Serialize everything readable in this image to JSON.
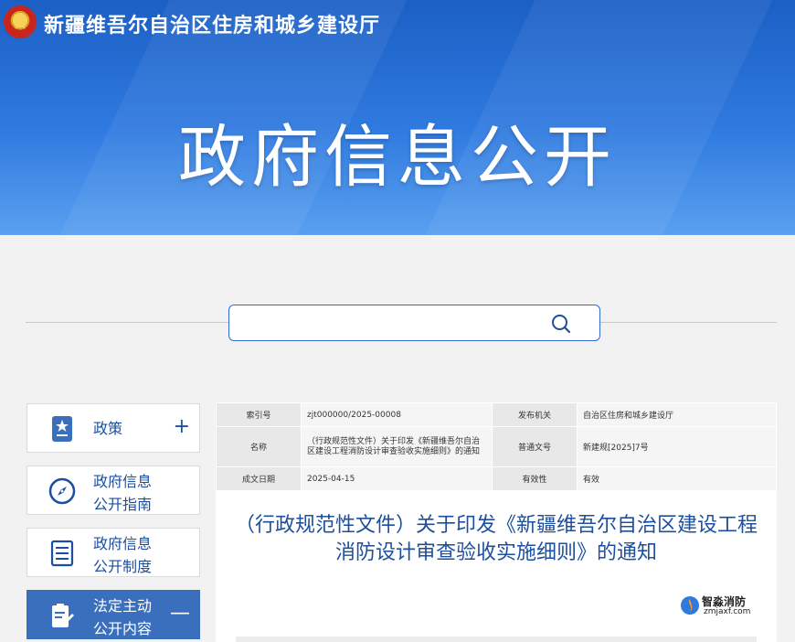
{
  "header": {
    "site_title": "新疆维吾尔自治区住房和城乡建设厅",
    "page_title": "政府信息公开"
  },
  "search": {
    "value": "",
    "placeholder": ""
  },
  "sidebar": {
    "items": [
      {
        "label": "政策",
        "toggle": "+"
      },
      {
        "label": "政府信息\n公开指南"
      },
      {
        "label": "政府信息\n公开制度"
      },
      {
        "label": "法定主动\n公开内容",
        "toggle": "—",
        "active": true
      }
    ]
  },
  "document": {
    "meta": {
      "index_label": "索引号",
      "index_value": "zjt000000/2025-00008",
      "org_label": "发布机关",
      "org_value": "自治区住房和城乡建设厅",
      "name_label": "名称",
      "name_value": "（行政规范性文件）关于印发《新疆维吾尔自治区建设工程消防设计审查验收实施细则》的通知",
      "doc_no_label": "普通文号",
      "doc_no_value": "新建规[2025]7号",
      "date_label": "成文日期",
      "date_value": "2025-04-15",
      "valid_label": "有效性",
      "valid_value": "有效"
    },
    "title": "（行政规范性文件）关于印发《新疆维吾尔自治区建设工程消防设计审查验收实施细则》的通知"
  },
  "watermark": {
    "name": "智淼消防",
    "url": "zmjaxf.com"
  },
  "colors": {
    "primary": "#1d4fa0",
    "banner": "#2f7ae0",
    "active": "#3a6fbd"
  }
}
